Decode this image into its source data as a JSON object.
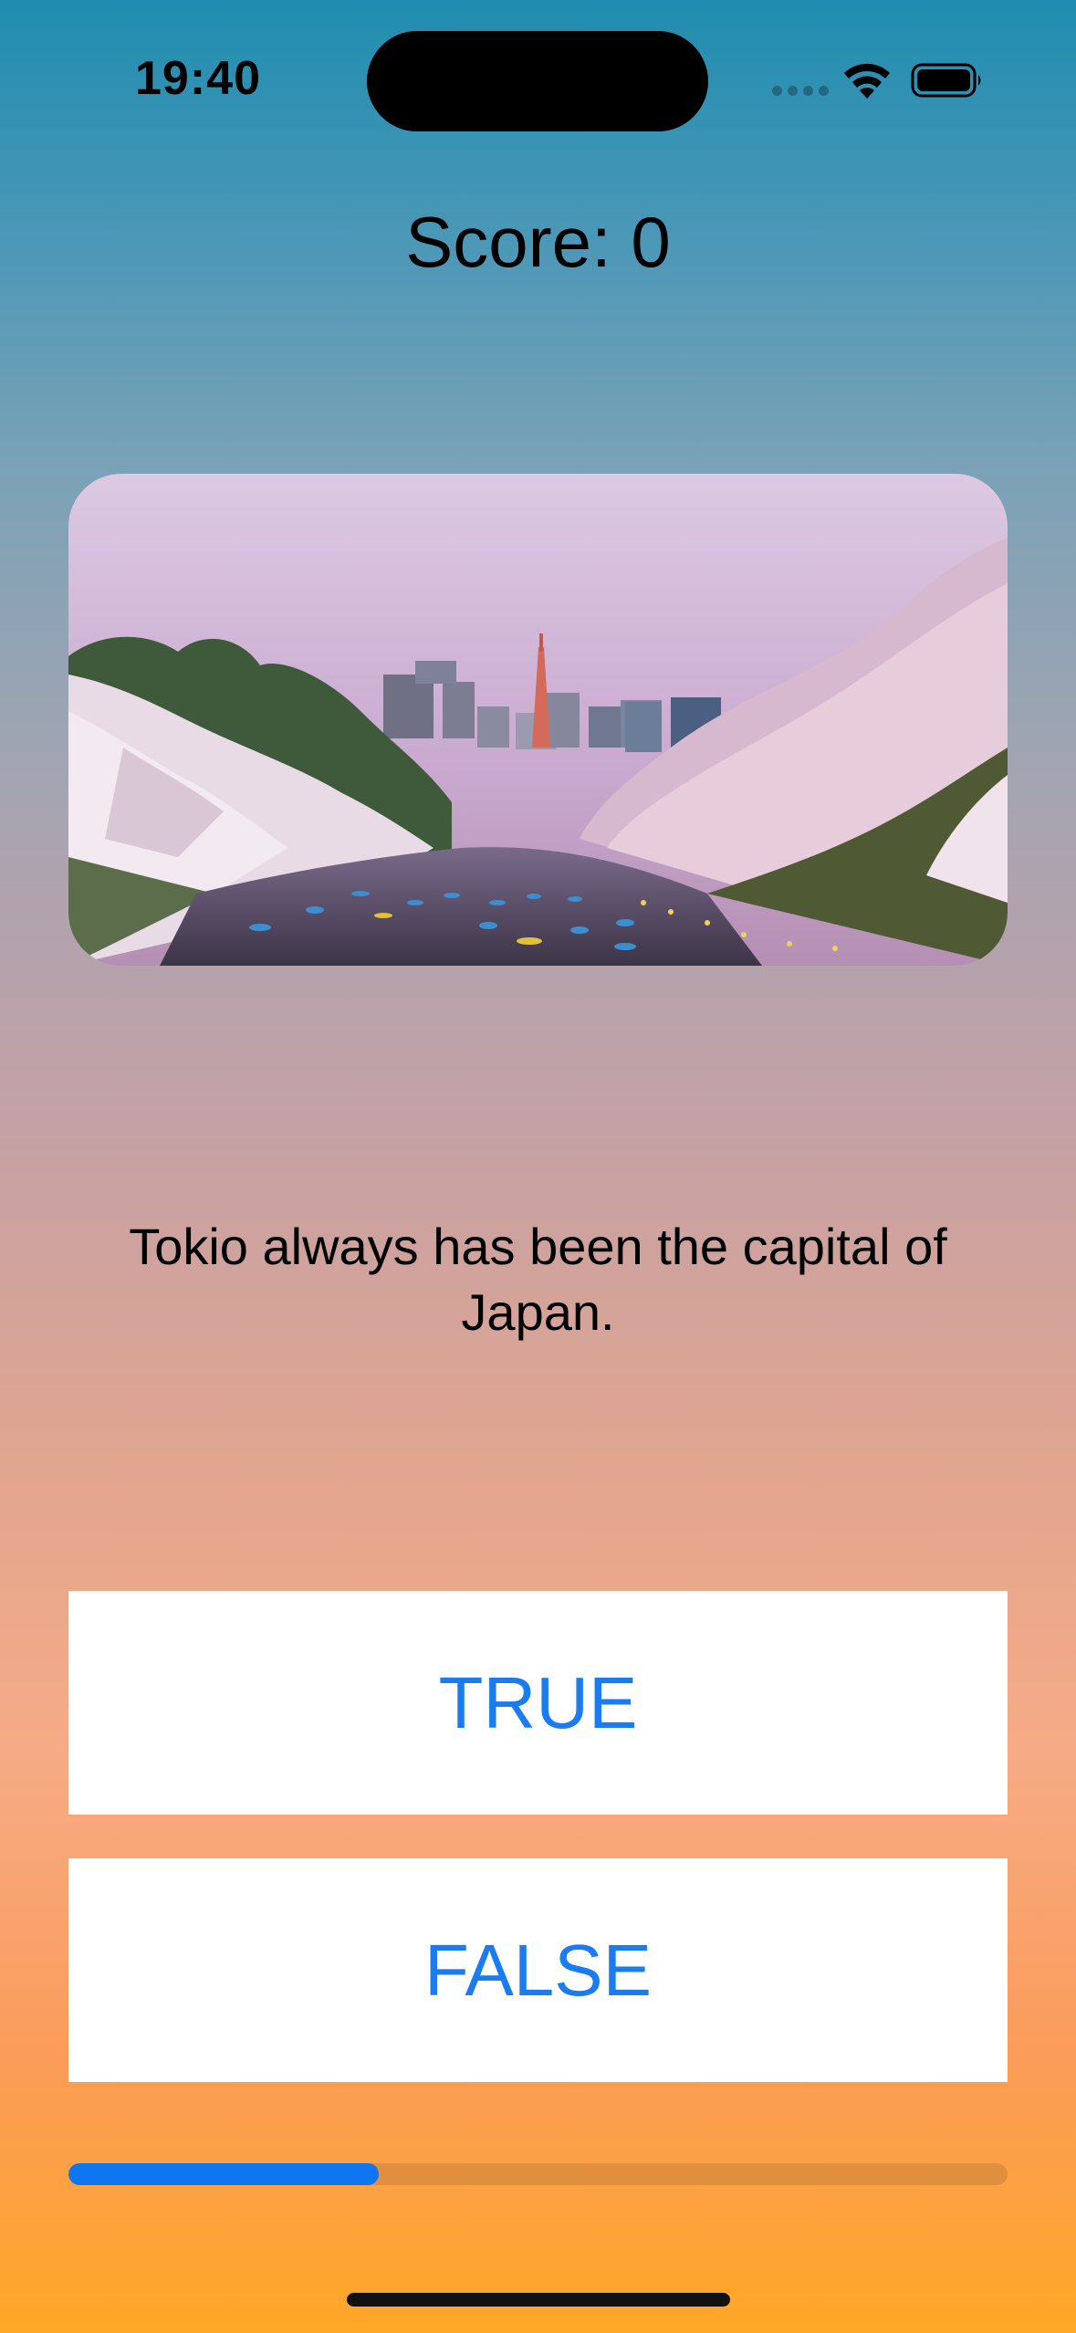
{
  "status_bar": {
    "time": "19:40",
    "icons": [
      "cellular-signal-icon",
      "wifi-icon",
      "battery-icon"
    ]
  },
  "score": {
    "label": "Score: 0"
  },
  "image": {
    "semantic": "cherry-blossom-canal-tokyo-photo"
  },
  "question": {
    "text": "Tokio always has been the capital of Japan."
  },
  "buttons": {
    "true_label": "TRUE",
    "false_label": "FALSE"
  },
  "progress": {
    "fraction": 0.33
  },
  "colors": {
    "accent": "#1a7cf0",
    "progress_fill": "#0f76f2",
    "gradient_top": "#1f8db0",
    "gradient_bottom": "#ffa726"
  }
}
